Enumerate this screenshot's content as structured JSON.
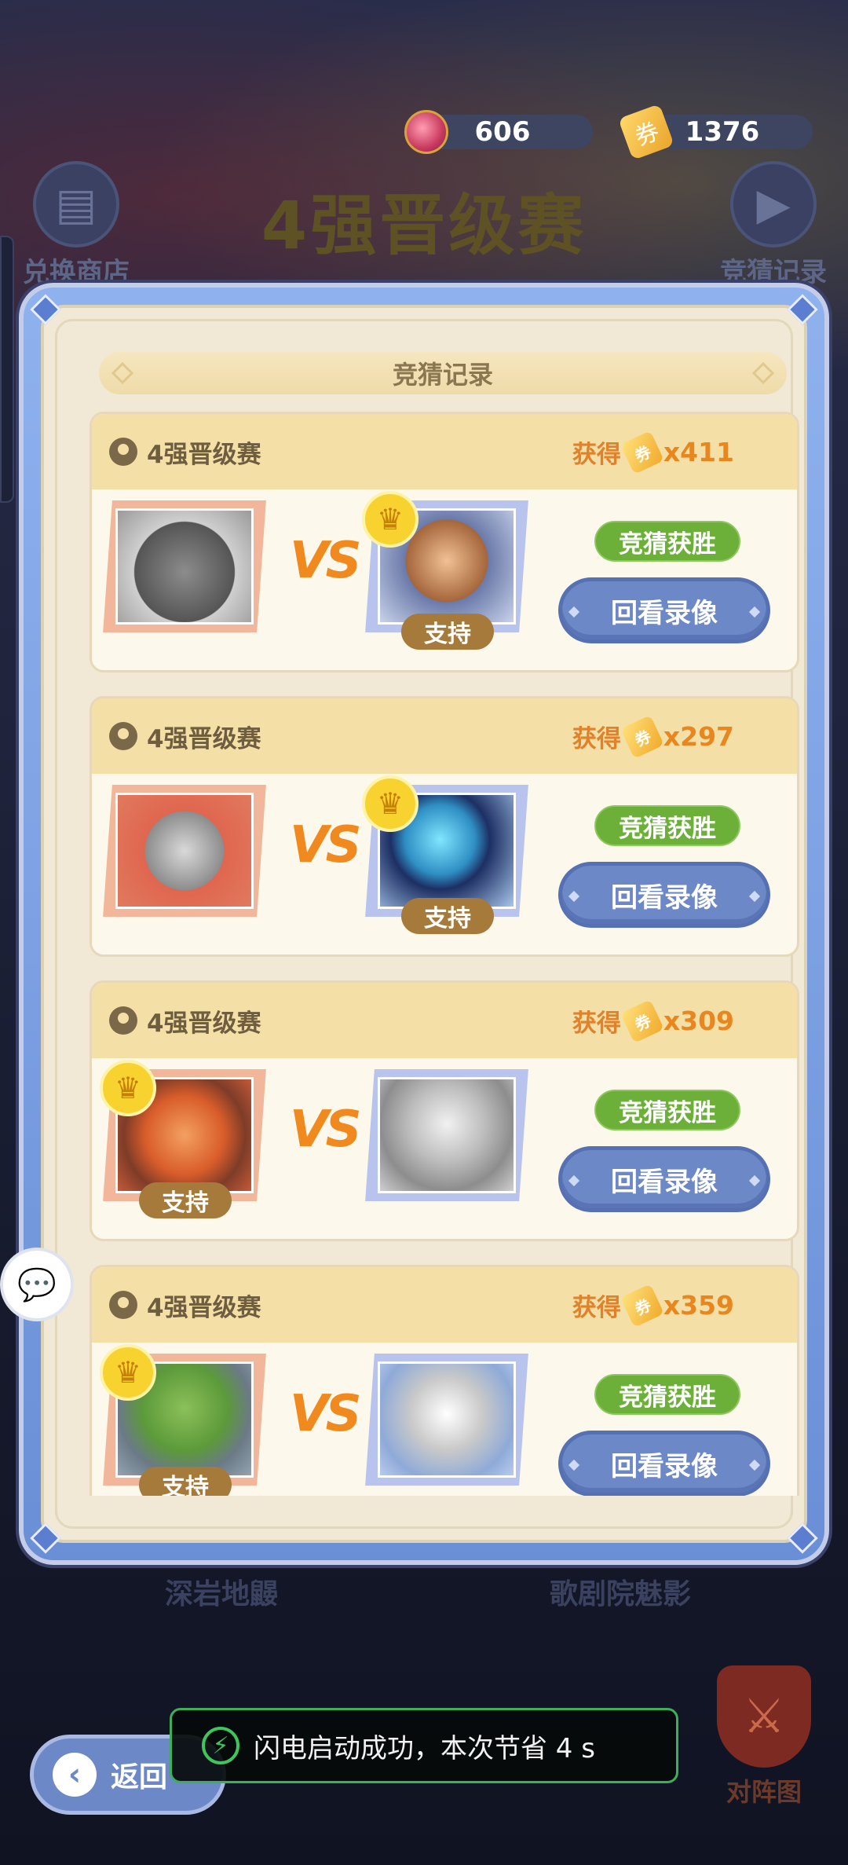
{
  "resources": {
    "gem_count": "606",
    "ticket_count": "1376",
    "gem_icon": "gem-icon",
    "ticket_icon": "ticket-icon"
  },
  "background": {
    "title": "4强晋级赛",
    "exchange_shop": "兑换商店",
    "guess_record": "竞猜记录",
    "bottom_left": "深岩地鼹",
    "bottom_right": "歌剧院魅影",
    "lineup": "对阵图"
  },
  "modal": {
    "title": "竞猜记录"
  },
  "records": [
    {
      "match": "4强晋级赛",
      "gain_label": "获得",
      "gain_count": "x411",
      "status": "竞猜获胜",
      "replay": "回看录像",
      "support": "支持",
      "supported_side": "right",
      "left_desc": "gray-rhino",
      "right_desc": "caveman"
    },
    {
      "match": "4强晋级赛",
      "gain_label": "获得",
      "gain_count": "x297",
      "status": "竞猜获胜",
      "replay": "回看录像",
      "support": "支持",
      "supported_side": "right",
      "left_desc": "gray-golem",
      "right_desc": "ice-mech"
    },
    {
      "match": "4强晋级赛",
      "gain_label": "获得",
      "gain_count": "x309",
      "status": "竞猜获胜",
      "replay": "回看录像",
      "support": "支持",
      "supported_side": "left",
      "left_desc": "fire-flower",
      "right_desc": "gray-robot"
    },
    {
      "match": "4强晋级赛",
      "gain_label": "获得",
      "gain_count": "x359",
      "status": "竞猜获胜",
      "replay": "回看录像",
      "support": "支持",
      "supported_side": "left",
      "left_desc": "moss-turtle",
      "right_desc": "gray-eagle"
    }
  ],
  "back_button": {
    "label": "返回"
  },
  "toast": {
    "text": "闪电启动成功，本次节省 4 s"
  },
  "colors": {
    "accent_blue": "#6d88c6",
    "win_green": "#6cb03a",
    "gain_orange": "#e8861f",
    "crown_gold": "#f8d22f"
  }
}
